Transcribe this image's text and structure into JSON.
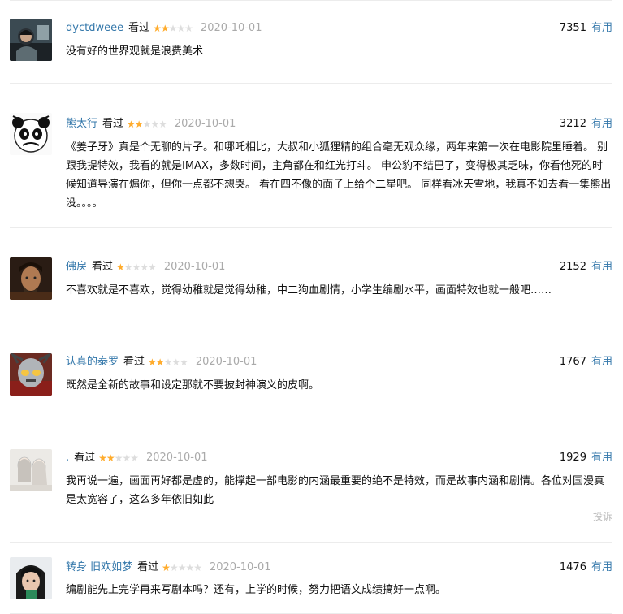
{
  "comments": [
    {
      "username": "dyctdweee",
      "status": "看过",
      "rating": 2,
      "date": "2020-10-01",
      "votes": "7351",
      "useful_label": "有用",
      "text": "没有好的世界观就是浪费美术"
    },
    {
      "username": "熊太行",
      "status": "看过",
      "rating": 2,
      "date": "2020-10-01",
      "votes": "3212",
      "useful_label": "有用",
      "text": "《姜子牙》真是个无聊的片子。和哪吒相比，大叔和小狐狸精的组合毫无观众缘，两年来第一次在电影院里睡着。 别跟我提特效，我看的就是IMAX，多数时间，主角都在和红光打斗。 申公豹不结巴了，变得极其乏味，你看他死的时候知道导演在煽你，但你一点都不想哭。 看在四不像的面子上给个二星吧。 同样看冰天雪地，我真不如去看一集熊出没。。。。"
    },
    {
      "username": "佛戾",
      "status": "看过",
      "rating": 1,
      "date": "2020-10-01",
      "votes": "2152",
      "useful_label": "有用",
      "text": "不喜欢就是不喜欢，觉得幼稚就是觉得幼稚，中二狗血剧情，小学生编剧水平，画面特效也就一般吧……"
    },
    {
      "username": "认真的泰罗",
      "status": "看过",
      "rating": 2,
      "date": "2020-10-01",
      "votes": "1767",
      "useful_label": "有用",
      "text": "既然是全新的故事和设定那就不要披封神演义的皮啊。"
    },
    {
      "username": ".",
      "status": "看过",
      "rating": 2,
      "date": "2020-10-01",
      "votes": "1929",
      "useful_label": "有用",
      "text": "我再说一遍，画面再好都是虚的，能撑起一部电影的内涵最重要的绝不是特效，而是故事内涵和剧情。各位对国漫真是太宽容了，这么多年依旧如此",
      "report_label": "投诉"
    },
    {
      "username": "转身 旧欢如梦",
      "status": "看过",
      "rating": 1,
      "date": "2020-10-01",
      "votes": "1476",
      "useful_label": "有用",
      "text": "编剧能先上完学再来写剧本吗？还有，上学的时候，努力把语文成绩搞好一点啊。"
    }
  ],
  "colors": {
    "link": "#3377aa",
    "star": "#ffac2d",
    "star_empty": "#dddddd",
    "muted": "#aaaaaa"
  }
}
